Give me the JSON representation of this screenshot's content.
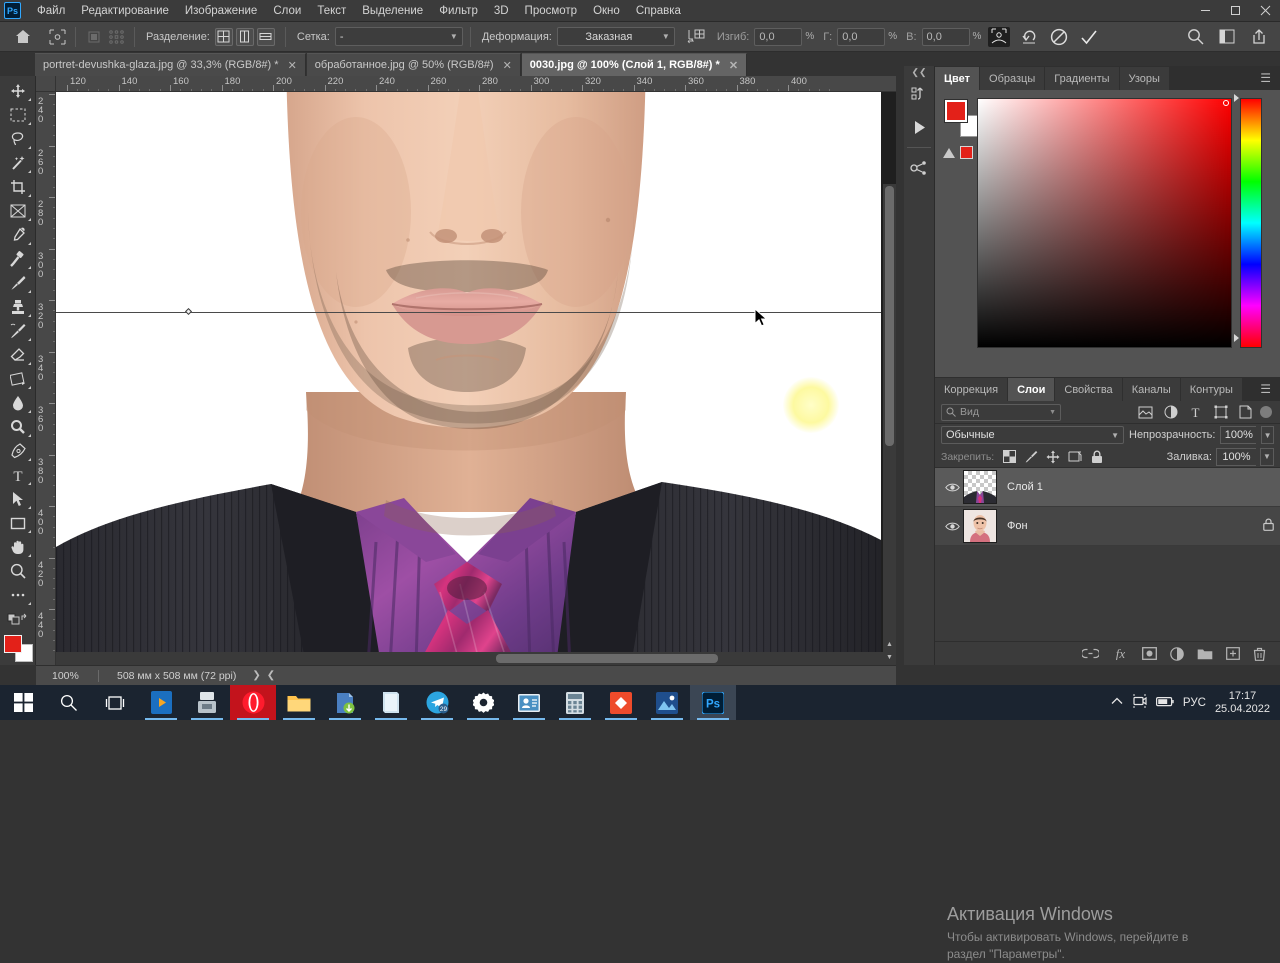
{
  "app": {
    "logo": "Ps",
    "menus": [
      "Файл",
      "Редактирование",
      "Изображение",
      "Слои",
      "Текст",
      "Выделение",
      "Фильтр",
      "3D",
      "Просмотр",
      "Окно",
      "Справка"
    ],
    "window_buttons": [
      "minimize",
      "maximize",
      "close"
    ]
  },
  "options_bar": {
    "home_icon": "home-icon",
    "puppet_icon": "puppet-warp-icon",
    "split_label": "Разделение:",
    "grid_label": "Сетка:",
    "grid_value": "-",
    "deform_label": "Деформация:",
    "deform_value": "Заказная",
    "bend_label": "Изгиб:",
    "bend_value": "0,0",
    "h_label": "Г:",
    "h_value": "0,0",
    "v_label": "В:",
    "v_value": "0,0",
    "percent": "%",
    "commit_icon": "checkmark-icon",
    "cancel_icon": "cancel-icon",
    "reset_icon": "reset-icon"
  },
  "document_tabs": [
    {
      "title": "portret-devushka-glaza.jpg @ 33,3% (RGB/8#) *",
      "active": false
    },
    {
      "title": "обработанное.jpg @ 50% (RGB/8#)",
      "active": false
    },
    {
      "title": "0030.jpg @ 100% (Слой 1, RGB/8#) *",
      "active": true
    }
  ],
  "toolbar": {
    "tools": [
      {
        "name": "move-tool",
        "glyph": "move"
      },
      {
        "name": "marquee-tool",
        "glyph": "marquee"
      },
      {
        "name": "lasso-tool",
        "glyph": "lasso"
      },
      {
        "name": "magic-wand-tool",
        "glyph": "wand"
      },
      {
        "name": "crop-tool",
        "glyph": "crop"
      },
      {
        "name": "frame-tool",
        "glyph": "frame"
      },
      {
        "name": "eyedropper-tool",
        "glyph": "eyedropper"
      },
      {
        "name": "healing-brush-tool",
        "glyph": "healing"
      },
      {
        "name": "brush-tool",
        "glyph": "brush"
      },
      {
        "name": "clone-stamp-tool",
        "glyph": "stamp"
      },
      {
        "name": "history-brush-tool",
        "glyph": "historybrush"
      },
      {
        "name": "eraser-tool",
        "glyph": "eraser"
      },
      {
        "name": "gradient-tool",
        "glyph": "gradient"
      },
      {
        "name": "blur-tool",
        "glyph": "blur"
      },
      {
        "name": "dodge-tool",
        "glyph": "dodge"
      },
      {
        "name": "pen-tool",
        "glyph": "pen"
      },
      {
        "name": "type-tool",
        "glyph": "type"
      },
      {
        "name": "path-selection-tool",
        "glyph": "pathselect"
      },
      {
        "name": "rectangle-tool",
        "glyph": "rectangle"
      },
      {
        "name": "hand-tool",
        "glyph": "hand"
      },
      {
        "name": "zoom-tool",
        "glyph": "zoom"
      },
      {
        "name": "edit-toolbar",
        "glyph": "ellipsis"
      }
    ],
    "foreground_color": "#e32119",
    "background_color": "#ffffff"
  },
  "rulers": {
    "horizontal_ticks": [
      120,
      140,
      160,
      180,
      200,
      220,
      240,
      260,
      280,
      300,
      320,
      340,
      360,
      380,
      400
    ],
    "vertical_ticks": [
      240,
      260,
      280,
      300,
      320,
      340,
      360,
      380,
      400,
      420,
      440
    ],
    "unit": "мм"
  },
  "status_bar": {
    "zoom": "100%",
    "doc_size": "508 мм x 508 мм (72 ppi)"
  },
  "dock_strip": {
    "icons": [
      "history-icon",
      "play-icon",
      "libraries-icon"
    ]
  },
  "color_panel": {
    "tabs": [
      {
        "label": "Цвет",
        "active": true
      },
      {
        "label": "Образцы",
        "active": false
      },
      {
        "label": "Градиенты",
        "active": false
      },
      {
        "label": "Узоры",
        "active": false
      }
    ],
    "menu_icon": "panel-menu-icon",
    "foreground": "#e32119",
    "background": "#ffffff",
    "out_of_gamut_color": "#e32119"
  },
  "layers_panel": {
    "tabs": [
      {
        "label": "Коррекция",
        "active": false
      },
      {
        "label": "Слои",
        "active": true
      },
      {
        "label": "Свойства",
        "active": false
      },
      {
        "label": "Каналы",
        "active": false
      },
      {
        "label": "Контуры",
        "active": false
      }
    ],
    "menu_icon": "panel-menu-icon",
    "filter_placeholder": "Вид",
    "filter_icons": [
      "pixel-filter-icon",
      "adjustment-filter-icon",
      "type-filter-icon",
      "shape-filter-icon",
      "smart-object-filter-icon"
    ],
    "blend_mode": "Обычные",
    "opacity_label": "Непрозрачность:",
    "opacity_value": "100%",
    "lock_label": "Закрепить:",
    "lock_icons": [
      "lock-transparent-icon",
      "lock-image-icon",
      "lock-position-icon",
      "lock-artboard-icon",
      "lock-all-icon"
    ],
    "fill_label": "Заливка:",
    "fill_value": "100%",
    "layers": [
      {
        "name": "Слой 1",
        "visible": true,
        "selected": true,
        "locked": false,
        "thumb": "transparent"
      },
      {
        "name": "Фон",
        "visible": true,
        "selected": false,
        "locked": true,
        "thumb": "portrait"
      }
    ],
    "footer_icons": [
      "link-layers-icon",
      "layer-style-fx-icon",
      "add-mask-icon",
      "adjustment-layer-icon",
      "new-group-icon",
      "new-layer-icon",
      "delete-layer-icon"
    ]
  },
  "windows_activation": {
    "title": "Активация Windows",
    "line1": "Чтобы активировать Windows, перейдите в",
    "line2": "раздел \"Параметры\"."
  },
  "taskbar": {
    "items": [
      {
        "name": "start-button",
        "icon": "windows-logo",
        "running": false
      },
      {
        "name": "search-button",
        "icon": "search-icon",
        "running": false
      },
      {
        "name": "task-view-button",
        "icon": "task-view-icon",
        "running": false
      },
      {
        "name": "taskbar-app-media",
        "icon": "media-player-icon",
        "running": true
      },
      {
        "name": "taskbar-app-scanner",
        "icon": "scanner-icon",
        "running": true
      },
      {
        "name": "taskbar-app-opera",
        "icon": "opera-icon",
        "running": true
      },
      {
        "name": "taskbar-app-explorer",
        "icon": "folder-icon",
        "running": true
      },
      {
        "name": "taskbar-app-downloader",
        "icon": "download-icon",
        "running": true
      },
      {
        "name": "taskbar-app-notes",
        "icon": "notes-icon",
        "running": true
      },
      {
        "name": "taskbar-app-telegram",
        "icon": "telegram-icon",
        "running": true,
        "badge": "29"
      },
      {
        "name": "taskbar-app-settings",
        "icon": "gear-icon",
        "running": true
      },
      {
        "name": "taskbar-app-contacts",
        "icon": "contacts-icon",
        "running": true
      },
      {
        "name": "taskbar-app-calculator",
        "icon": "calculator-icon",
        "running": true
      },
      {
        "name": "taskbar-app-converter",
        "icon": "converter-icon",
        "running": true
      },
      {
        "name": "taskbar-app-photos",
        "icon": "photos-icon",
        "running": true
      },
      {
        "name": "taskbar-app-photoshop",
        "icon": "photoshop-icon",
        "running": true,
        "active": true
      }
    ],
    "tray": {
      "chevron": "show-hidden-icons",
      "icons": [
        "camera-icon",
        "battery-icon"
      ],
      "language": "РУС",
      "time": "17:17",
      "date": "25.04.2022"
    }
  }
}
